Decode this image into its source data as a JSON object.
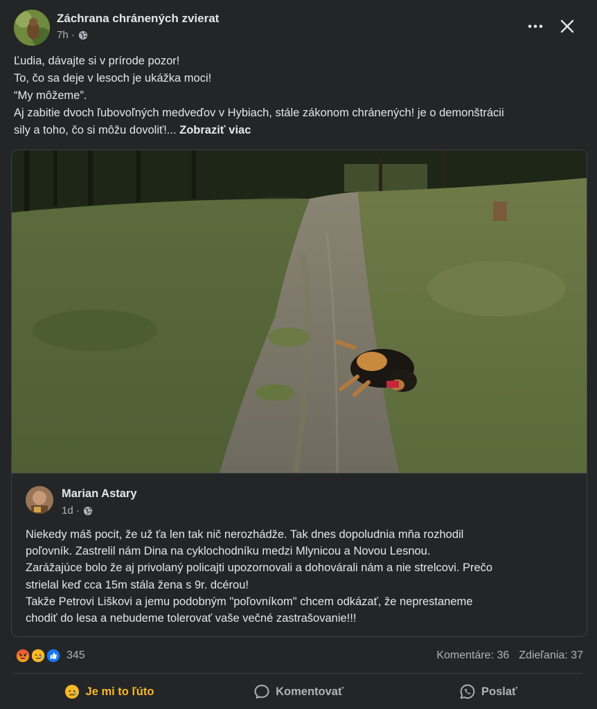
{
  "post": {
    "page_name": "Záchrana chránených zvierat",
    "time": "7h ·",
    "audience_icon": "globe-icon",
    "text_lines": [
      "Ľudia, dávajte si v prírode pozor!",
      "To, čo sa deje v lesoch je ukážka moci!",
      "“My môžeme”.",
      "Aj zabitie dvoch ľubovoľných medveďov v Hybiach, stále zákonom chránených! je o demonštrácii",
      "sily a toho, čo si môžu dovoliť!... "
    ],
    "see_more": "Zobraziť viac"
  },
  "shared_post": {
    "author": "Marian Astary",
    "time": "1d ·",
    "text_lines": [
      "Niekedy máš pocit, že už ťa len tak nič nerozhádže. Tak dnes dopoludnia mňa rozhodil",
      "poľovník. Zastrelil nám Dina na cyklochodníku medzi Mlynicou a Novou Lesnou.",
      "Zarážajúce bolo že aj privolaný policajti upozornovali a dohovárali nám a nie strelcovi. Prečo",
      "strielal keď cca 15m stála žena s 9r. dcérou!",
      "Takže Petrovi Liškovi a jemu podobným \"poľovníkom\" chcem odkázať, že neprestaneme",
      "chodiť do lesa a nebudeme tolerovať vaše večné zastrašovanie!!!"
    ]
  },
  "reactions": {
    "icons": [
      "angry-icon",
      "sad-icon",
      "like-icon"
    ],
    "count": "345",
    "comments": "Komentáre: 36",
    "shares": "Zdieľania: 37"
  },
  "actions": {
    "react_label": "Je mi to ľúto",
    "comment_label": "Komentovať",
    "send_label": "Poslať"
  },
  "colors": {
    "background": "#242526",
    "text_primary": "#e4e6eb",
    "text_secondary": "#b0b3b8",
    "sad_reaction": "#f7b928",
    "like_blue": "#1877f2",
    "angry_red": "#e9710f"
  }
}
